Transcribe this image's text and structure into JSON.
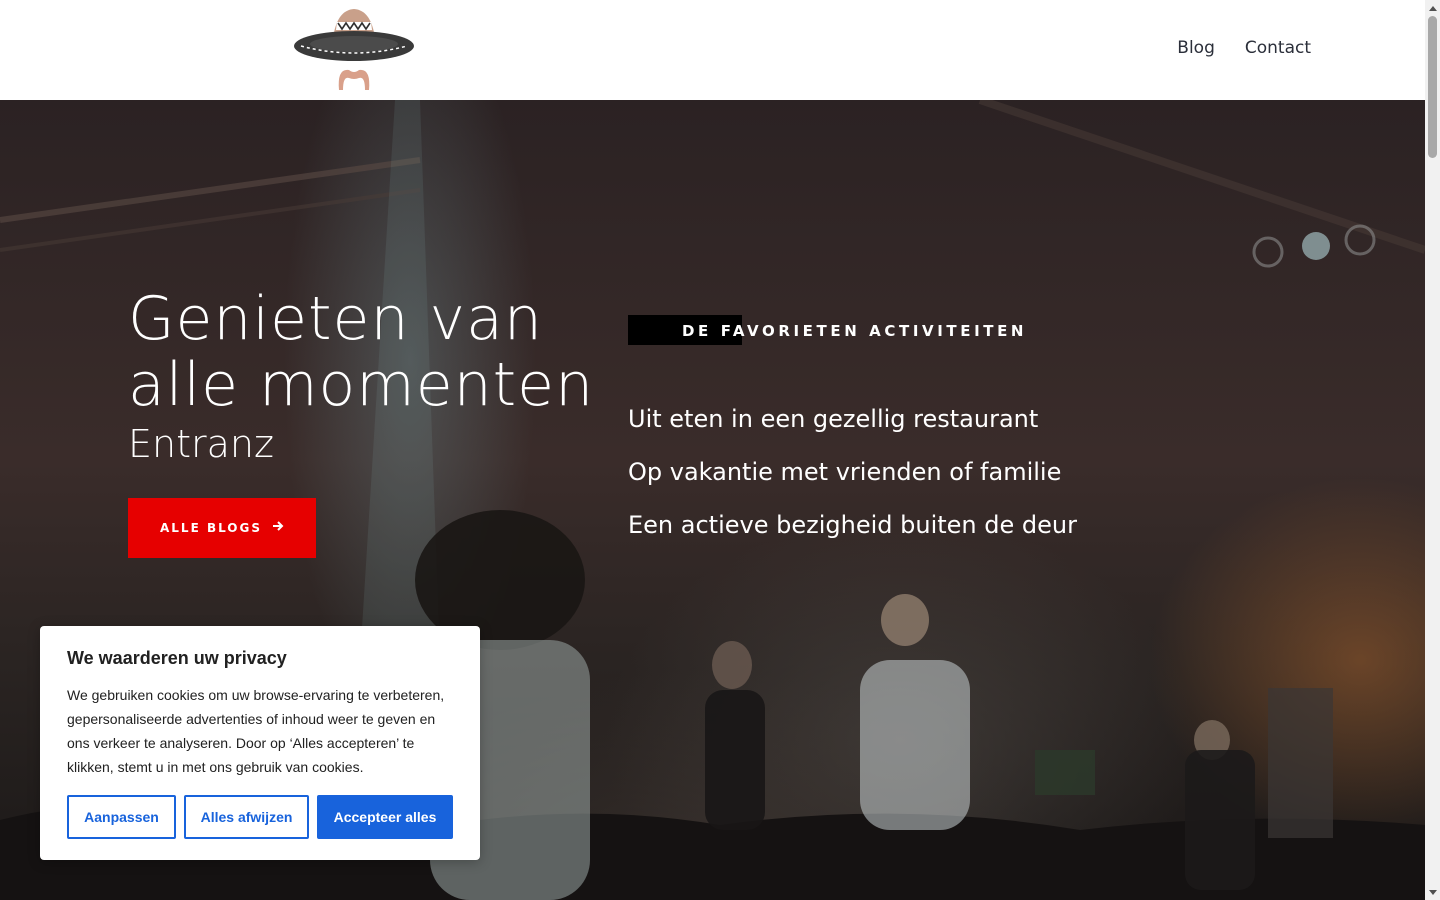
{
  "header": {
    "logo_alt": "sombrero-logo",
    "nav": [
      {
        "label": "Blog"
      },
      {
        "label": "Contact"
      }
    ]
  },
  "hero": {
    "title_line1": "Genieten van",
    "title_line2": "alle momenten",
    "subtitle": "Entranz",
    "cta_label": "ALLE BLOGS",
    "cta_icon": "arrow-right-icon",
    "section_label": "DE FAVORIETEN ACTIVITEITEN",
    "activities": [
      "Uit eten in een gezellig restaurant",
      "Op vakantie met vrienden of familie",
      "Een actieve bezigheid buiten de deur"
    ]
  },
  "cookie": {
    "title": "We waarderen uw privacy",
    "text": "We gebruiken cookies om uw browse-ervaring te verbeteren, gepersonaliseerde advertenties of inhoud weer te geven en ons verkeer te analyseren. Door op ‘Alles accepteren’ te klikken, stemt u in met ons gebruik van cookies.",
    "customize_label": "Aanpassen",
    "reject_label": "Alles afwijzen",
    "accept_label": "Accepteer alles"
  },
  "colors": {
    "cta": "#e60000",
    "cookie_accent": "#1863dc",
    "nav_text": "#2b2f3a"
  }
}
